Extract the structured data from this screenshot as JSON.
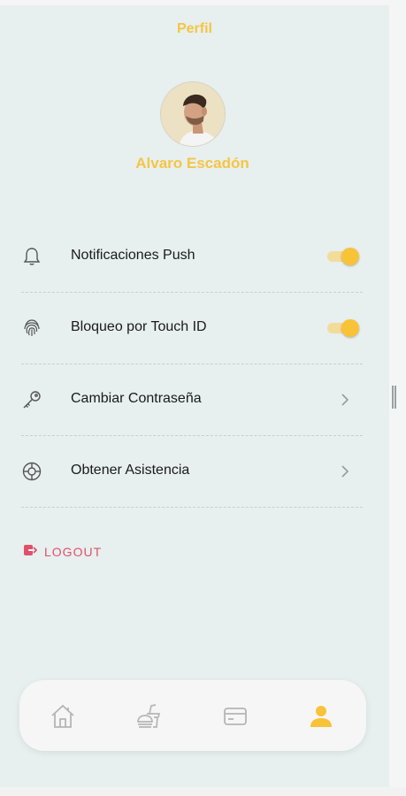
{
  "header": {
    "title": "Perfil"
  },
  "profile": {
    "name": "Alvaro Escadón"
  },
  "menu": {
    "items": [
      {
        "label": "Notificaciones Push",
        "icon": "bell-icon",
        "control": "toggle",
        "on": true
      },
      {
        "label": "Bloqueo por Touch ID",
        "icon": "fingerprint-icon",
        "control": "toggle",
        "on": true
      },
      {
        "label": "Cambiar Contraseña",
        "icon": "key-icon",
        "control": "chevron"
      },
      {
        "label": "Obtener Asistencia",
        "icon": "lifebuoy-icon",
        "control": "chevron"
      }
    ]
  },
  "logout": {
    "label": "LOGOUT",
    "icon": "logout-icon"
  },
  "bottom_nav": {
    "items": [
      {
        "icon": "home-icon",
        "active": false
      },
      {
        "icon": "food-icon",
        "active": false
      },
      {
        "icon": "card-icon",
        "active": false
      },
      {
        "icon": "user-icon",
        "active": true
      }
    ]
  },
  "colors": {
    "accent": "#f6c542",
    "background": "#e7efef",
    "logout": "#e0506a",
    "icon_inactive": "#b5b5b5"
  }
}
